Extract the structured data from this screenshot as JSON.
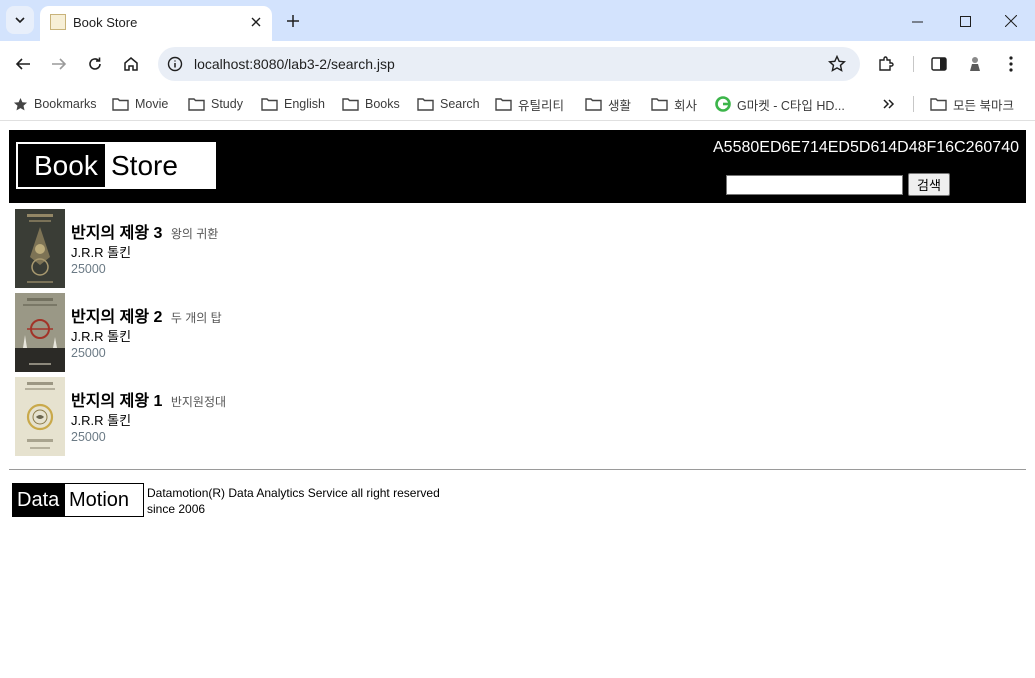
{
  "browser": {
    "tab_title": "Book Store",
    "url": "localhost:8080/lab3-2/search.jsp",
    "bookmarks": [
      {
        "label": "Bookmarks",
        "icon": "star-icon"
      },
      {
        "label": "Movie",
        "icon": "folder-icon"
      },
      {
        "label": "Study",
        "icon": "folder-icon"
      },
      {
        "label": "English",
        "icon": "folder-icon"
      },
      {
        "label": "Books",
        "icon": "folder-icon"
      },
      {
        "label": "Search",
        "icon": "folder-icon"
      },
      {
        "label": "유틸리티",
        "icon": "folder-icon"
      },
      {
        "label": "생활",
        "icon": "folder-icon"
      },
      {
        "label": "회사",
        "icon": "folder-icon"
      },
      {
        "label": "G마켓 - C타입 HD...",
        "icon": "gmarket-icon"
      }
    ],
    "all_bookmarks": "모든 북마크"
  },
  "page": {
    "logo": {
      "part1": "Book",
      "part2": "Store"
    },
    "session_id": "A5580ED6E714ED5D614D48F16C260740",
    "search": {
      "value": "",
      "button_label": "검색"
    },
    "books": [
      {
        "title": "반지의 제왕 3",
        "subtitle": "왕의 귀환",
        "author": "J.R.R 톨킨",
        "price": "25000",
        "cover_color": "#3a3d36"
      },
      {
        "title": "반지의 제왕 2",
        "subtitle": "두 개의 탑",
        "author": "J.R.R 톨킨",
        "price": "25000",
        "cover_color": "#9a9886"
      },
      {
        "title": "반지의 제왕 1",
        "subtitle": "반지원정대",
        "author": "J.R.R 톨킨",
        "price": "25000",
        "cover_color": "#e6e2cf"
      }
    ],
    "footer": {
      "logo_part1": "Data",
      "logo_part2": "Motion",
      "line1": "Datamotion(R) Data Analytics Service all right reserved",
      "line2": "since 2006"
    }
  }
}
